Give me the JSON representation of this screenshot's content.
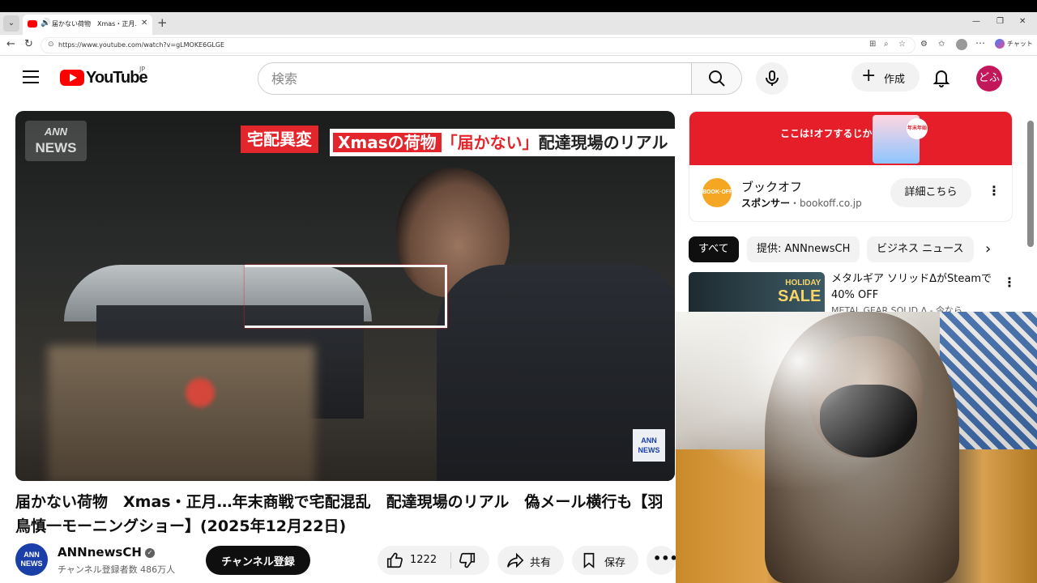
{
  "browser": {
    "tab_title": "届かない荷物　Xmas・正月…年",
    "url": "https://www.youtube.com/watch?v=gLMOKE6GLGE",
    "chat_label": "チャット"
  },
  "youtube": {
    "logo_text": "YouTube",
    "region": "JP",
    "search_placeholder": "検索",
    "create_label": "作成",
    "avatar_text": "どふ"
  },
  "video": {
    "overlay_logo_line1": "ANN",
    "overlay_logo_line2": "NEWS",
    "caption_tag": "宅配異変",
    "caption_xmas": "Xmasの荷物",
    "caption_red": "「届かない」",
    "caption_rest": "配達現場のリアル",
    "corner_line1": "ANN",
    "corner_line2": "NEWS",
    "title": "届かない荷物　Xmas・正月…年末商戦で宅配混乱　配達現場のリアル　偽メール横行も【羽鳥慎一モーニングショー】(2025年12月22日)"
  },
  "channel": {
    "avatar_line1": "ANN",
    "avatar_line2": "NEWS",
    "name": "ANNnewsCH",
    "verified": "✓",
    "subscribers": "チャンネル登録者数 486万人",
    "subscribe_label": "チャンネル登録"
  },
  "actions": {
    "likes": "1222",
    "share_label": "共有",
    "save_label": "保存"
  },
  "ad": {
    "banner_text": "ここは!オフするじかん。",
    "banner_badge": "年末年始",
    "logo_text": "BOOK·OFF",
    "name": "ブックオフ",
    "sponsor_label": "スポンサー",
    "domain": "・bookoff.co.jp",
    "cta_label": "詳細こちら"
  },
  "chips": [
    "すべて",
    "提供: ANNnewsCH",
    "ビジネス ニュース"
  ],
  "recommended": {
    "sale_line1": "HOLIDAY",
    "sale_line2": "SALE",
    "title": "メタルギア ソリッドΔがSteamで40% OFF",
    "channel": "METAL GEAR SOLID Δ - 今なら"
  }
}
